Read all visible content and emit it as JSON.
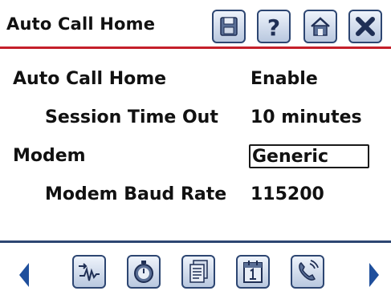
{
  "header": {
    "title": "Auto Call Home",
    "buttons": [
      {
        "name": "save",
        "icon": "save-disk-icon"
      },
      {
        "name": "help",
        "icon": "question-icon"
      },
      {
        "name": "home",
        "icon": "home-icon"
      },
      {
        "name": "close",
        "icon": "close-x-icon"
      }
    ]
  },
  "settings": {
    "auto_call_home": {
      "label": "Auto Call Home",
      "value": "Enable"
    },
    "session_time_out": {
      "label": "Session Time Out",
      "value": "10 minutes"
    },
    "modem": {
      "label": "Modem",
      "value": "Generic"
    },
    "modem_baud_rate": {
      "label": "Modem Baud Rate",
      "value": "115200"
    }
  },
  "toolbar": {
    "items": [
      {
        "name": "signal",
        "icon": "signal-waveform-icon"
      },
      {
        "name": "diagnostics",
        "icon": "stopwatch-icon"
      },
      {
        "name": "documents",
        "icon": "documents-icon"
      },
      {
        "name": "calendar",
        "icon": "calendar-icon"
      },
      {
        "name": "phone",
        "icon": "phone-call-icon"
      }
    ]
  },
  "colors": {
    "accent_red": "#c41f2a",
    "navy": "#2d4672",
    "arrow_blue": "#1f4f9c"
  }
}
